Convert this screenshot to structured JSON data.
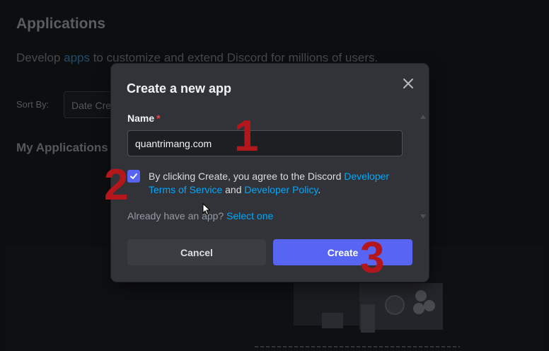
{
  "background": {
    "title": "Applications",
    "description_prefix": "Develop ",
    "description_link": "apps",
    "description_suffix": " to customize and extend Discord for millions of users.",
    "sort_label": "Sort By:",
    "sort_value": "Date Cre",
    "my_apps_heading": "My Applications"
  },
  "modal": {
    "title": "Create a new app",
    "name_label": "Name",
    "required_mark": "*",
    "name_value": "quantrimang.com",
    "checkbox_checked": true,
    "agree_prefix": "By clicking Create, you agree to the Discord ",
    "tos_link": "Developer Terms of Service",
    "agree_mid": " and ",
    "policy_link": "Developer Policy",
    "agree_suffix": ".",
    "already_text": "Already have an app? ",
    "select_link": "Select one",
    "cancel_label": "Cancel",
    "create_label": "Create"
  },
  "annotations": {
    "step1": "1",
    "step2": "2",
    "step3": "3"
  },
  "colors": {
    "accent": "#5865f2",
    "link": "#00a8fc",
    "marker": "#b3171c",
    "modal_bg": "#313338"
  },
  "icons": {
    "close": "close-icon",
    "check": "checkmark-icon",
    "cursor": "mouse-cursor-icon"
  }
}
